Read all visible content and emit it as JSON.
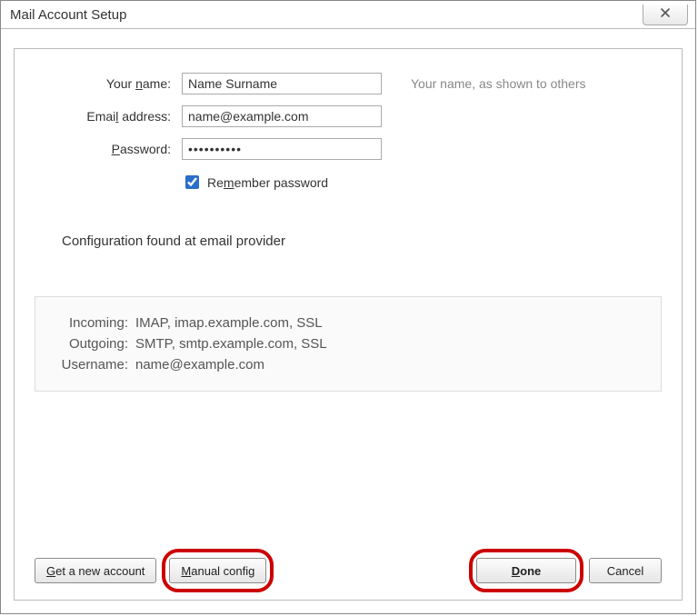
{
  "window": {
    "title": "Mail Account Setup"
  },
  "form": {
    "name_label_pre": "Your ",
    "name_label_u": "n",
    "name_label_post": "ame:",
    "name_value": "Name Surname",
    "name_hint": "Your name, as shown to others",
    "email_label_pre": "Emai",
    "email_label_u": "l",
    "email_label_post": " address:",
    "email_value": "name@example.com",
    "password_label_u": "P",
    "password_label_post": "assword:",
    "password_value": "••••••••••",
    "remember_checked": true,
    "remember_pre": "Re",
    "remember_u": "m",
    "remember_post": "ember password"
  },
  "status": "Configuration found at email provider",
  "details": {
    "incoming_label": "Incoming:",
    "incoming_value": "IMAP, imap.example.com, SSL",
    "outgoing_label": "Outgoing:",
    "outgoing_value": "SMTP, smtp.example.com, SSL",
    "username_label": "Username:",
    "username_value": "name@example.com"
  },
  "buttons": {
    "get_new_u": "G",
    "get_new_post": "et a new account",
    "manual_u": "M",
    "manual_post": "anual config",
    "done_u": "D",
    "done_post": "one",
    "cancel": "Cancel"
  }
}
